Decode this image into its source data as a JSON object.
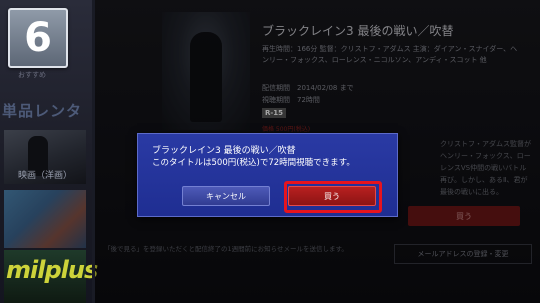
{
  "step_number": "6",
  "left_rail": {
    "osusume": "おすすめ",
    "heading": "単品レンタ",
    "caption1": "映画（洋画）",
    "logo": "milplus"
  },
  "movie": {
    "title": "ブラックレイン3 最後の戦い／吹替",
    "info": "再生時間：166分 監督：クリストフ・アダムス 主演：ダイアン・スナイダー、ヘンリー・フォックス、ローレンス・ニコルソン、アンディ・スコット 他",
    "delivery_period": "配信期間　2014/02/08 まで",
    "viewing_period": "視聴期間　72時間",
    "rating": "R-15",
    "price_label": "価格 500円(税込)",
    "synopsis": "クリストフ・アダムス監督がヘンリー・フォックス、ローレンスVS仲間の戦いバトル再び。しかし、あるⅡ、君が最後の戦いに出る。",
    "buy_label": "買う",
    "mail_register": "メールアドレスの登録・変更",
    "footer_note": "「後で見る」を登録いただくと配信終了の1週間前にお知らせメールを送信します。"
  },
  "dialog": {
    "title": "ブラックレイン3 最後の戦い／吹替",
    "message": "このタイトルは500円(税込)で72時間視聴できます。",
    "cancel_label": "キャンセル",
    "buy_label": "買う"
  },
  "colors": {
    "dialog_bg": "#2433a0",
    "buy_button": "#b82020",
    "highlight": "#e6141e"
  }
}
